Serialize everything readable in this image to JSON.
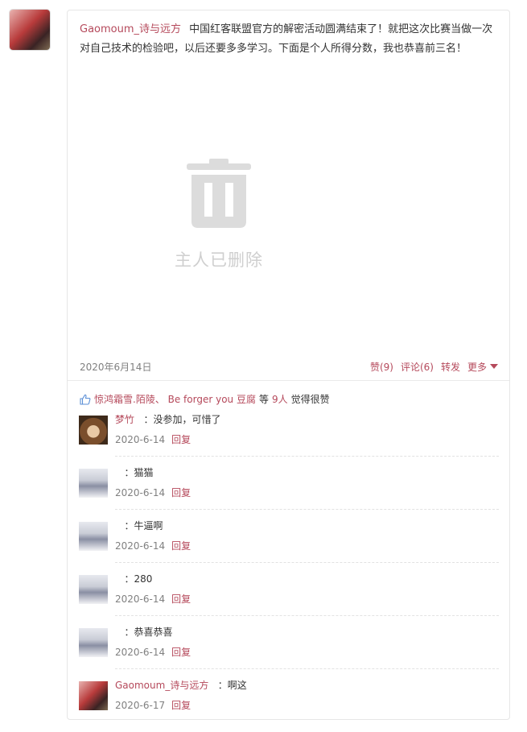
{
  "post": {
    "author": "Gaomoum_诗与远方",
    "text": "中国红客联盟官方的解密活动圆满结束了！就把这次比赛当做一次对自己技术的检验吧，以后还要多多学习。下面是个人所得分数，我也恭喜前三名！",
    "deleted_label": "主人已删除",
    "date": "2020年6月14日",
    "actions": {
      "like": "赞(9)",
      "comment": "评论(6)",
      "share": "转发",
      "more": "更多"
    }
  },
  "likes": {
    "users": "惊鸿霜雪.陌陵、 Be forger you 豆腐",
    "count_prefix": "等",
    "count": "9人",
    "suffix": "觉得很赞"
  },
  "comments": [
    {
      "name": "梦竹",
      "text": "：没参加，可惜了",
      "date": "2020-6-14",
      "reply": "回复",
      "avatar": "monkey"
    },
    {
      "name": "",
      "text": "：猫猫",
      "date": "2020-6-14",
      "reply": "回复",
      "avatar": "anime"
    },
    {
      "name": "",
      "text": "：牛逼啊",
      "date": "2020-6-14",
      "reply": "回复",
      "avatar": "anime"
    },
    {
      "name": "",
      "text": "：280",
      "date": "2020-6-14",
      "reply": "回复",
      "avatar": "anime"
    },
    {
      "name": "",
      "text": "：恭喜恭喜",
      "date": "2020-6-14",
      "reply": "回复",
      "avatar": "anime"
    },
    {
      "name": "Gaomoum_诗与远方",
      "text": "：啊这",
      "date": "2020-6-17",
      "reply": "回复",
      "avatar": "red"
    }
  ],
  "colors": {
    "accent": "#b5495b",
    "muted": "#808080",
    "deleted_gray": "#d9d9d9"
  }
}
